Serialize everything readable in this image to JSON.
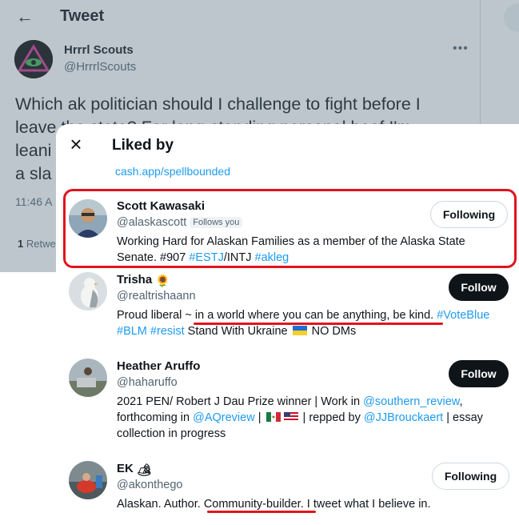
{
  "background": {
    "back_icon": "arrow-left-icon",
    "title": "Tweet",
    "author_name": "Hrrrl Scouts",
    "author_handle": "@HrrrlScouts",
    "more_icon": "more-dots-icon",
    "text_lines": [
      "Which ak politician should I challenge to fight before I",
      "leave the state? For long-standing personal beef I'm",
      "leani",
      "a sla"
    ],
    "time": "11:46 A",
    "retweets_count": "1",
    "retweets_label": "Retwe"
  },
  "modal": {
    "close_icon": "close-icon",
    "title": "Liked by",
    "top_link": "cash.app/spellbounded",
    "users": [
      {
        "name": "Scott Kawasaki",
        "handle": "@alaskascott",
        "badge": "Follows you",
        "bio_1": "Working Hard for Alaskan Families as a member of the Alaska State",
        "bio_2a": "Senate. #907 ",
        "bio_2b": "#ESTJ",
        "bio_2c": "/INTJ ",
        "bio_2d": "#akleg",
        "button": "Following"
      },
      {
        "name": "Trisha",
        "name_emoji": "🌻",
        "handle": "@realtrishaann",
        "bio_1a": "Proud liberal ~ in a world where you can be anything, be kind. ",
        "bio_1b": "#VoteBlue",
        "bio_2a": "#BLM",
        "bio_2b": "#resist",
        "bio_2c": " Stand With Ukraine ",
        "bio_2d": " NO DMs",
        "button": "Follow"
      },
      {
        "name": "Heather Aruffo",
        "handle": "@haharuffo",
        "bio_1a": "2021 PEN/ Robert J Dau Prize winner | Work in ",
        "bio_1b": "@southern_review",
        "bio_1c": ",",
        "bio_2a": "forthcoming in ",
        "bio_2b": "@AQreview",
        "bio_2c": " | ",
        "bio_2d": " | repped by ",
        "bio_2e": "@JJBrouckaert",
        "bio_2f": " | essay",
        "bio_3": "collection in progress",
        "button": "Follow"
      },
      {
        "name": "EK",
        "name_emoji": "🏕",
        "handle": "@akonthego",
        "bio_1": "Alaskan. Author. Community-builder. I tweet what I believe in.",
        "button": "Following"
      }
    ]
  },
  "colors": {
    "accent": "#1d9bf0",
    "annotation": "#e0141e",
    "follow_button": "#0f1419"
  }
}
